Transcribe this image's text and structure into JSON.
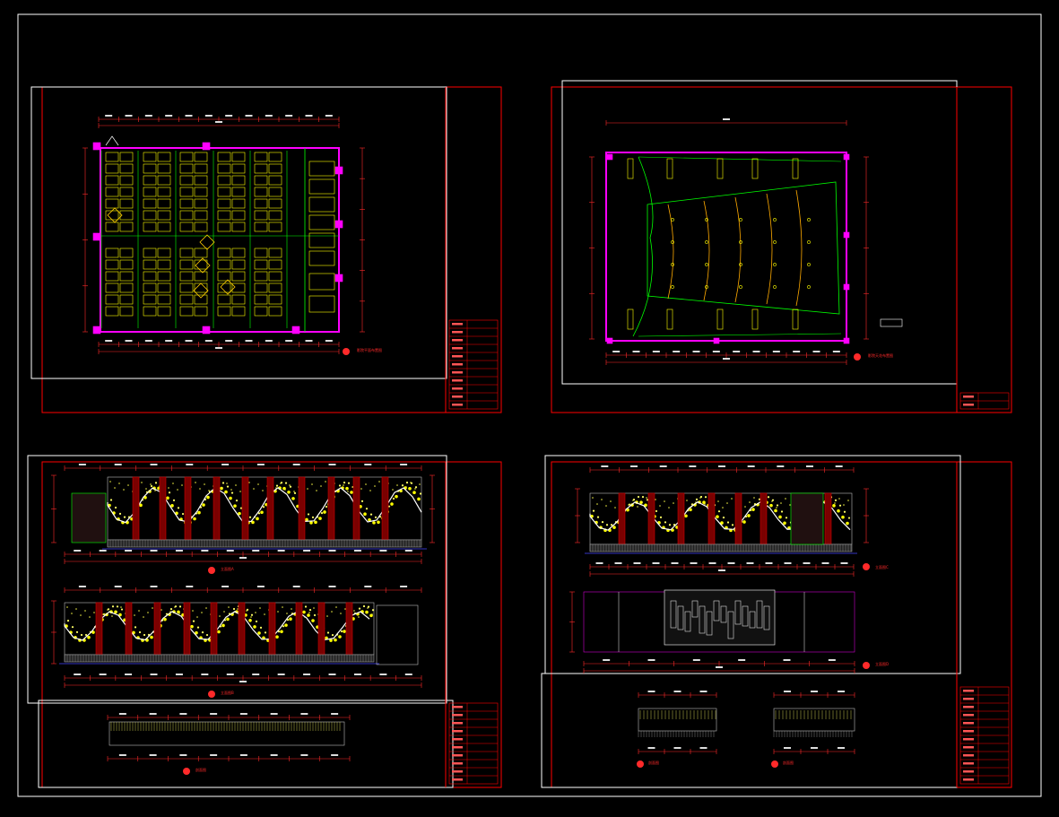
{
  "drawing": {
    "background": "#000000",
    "colors": {
      "frame": "#ffffff",
      "sheet_border": "#ff0000",
      "wall": "#ff00ff",
      "seat": "#ffff00",
      "green_line": "#00ff00",
      "ceiling_ring": "#ffaa00",
      "dimension": "#ff2a2a",
      "cyan": "#00ffff",
      "magenta_marker": "#ff00ff"
    },
    "sheets": [
      {
        "id": "floor-plan",
        "caption": "影院平面布置图"
      },
      {
        "id": "ceiling-plan",
        "caption": "影院天花布置图"
      },
      {
        "id": "elevation-a",
        "caption": "立面图A"
      },
      {
        "id": "elevation-b",
        "caption": "立面图B"
      },
      {
        "id": "elevation-c",
        "caption": "立面图C"
      },
      {
        "id": "elevation-d",
        "caption": "立面图D"
      },
      {
        "id": "section-1",
        "caption": "剖面图"
      },
      {
        "id": "section-2",
        "caption": "剖面图"
      },
      {
        "id": "section-3",
        "caption": "剖面图"
      }
    ],
    "title_blocks": [
      {
        "id": "tb-top-left"
      },
      {
        "id": "tb-top-right"
      },
      {
        "id": "tb-bottom-left"
      },
      {
        "id": "tb-bottom-right"
      }
    ]
  }
}
